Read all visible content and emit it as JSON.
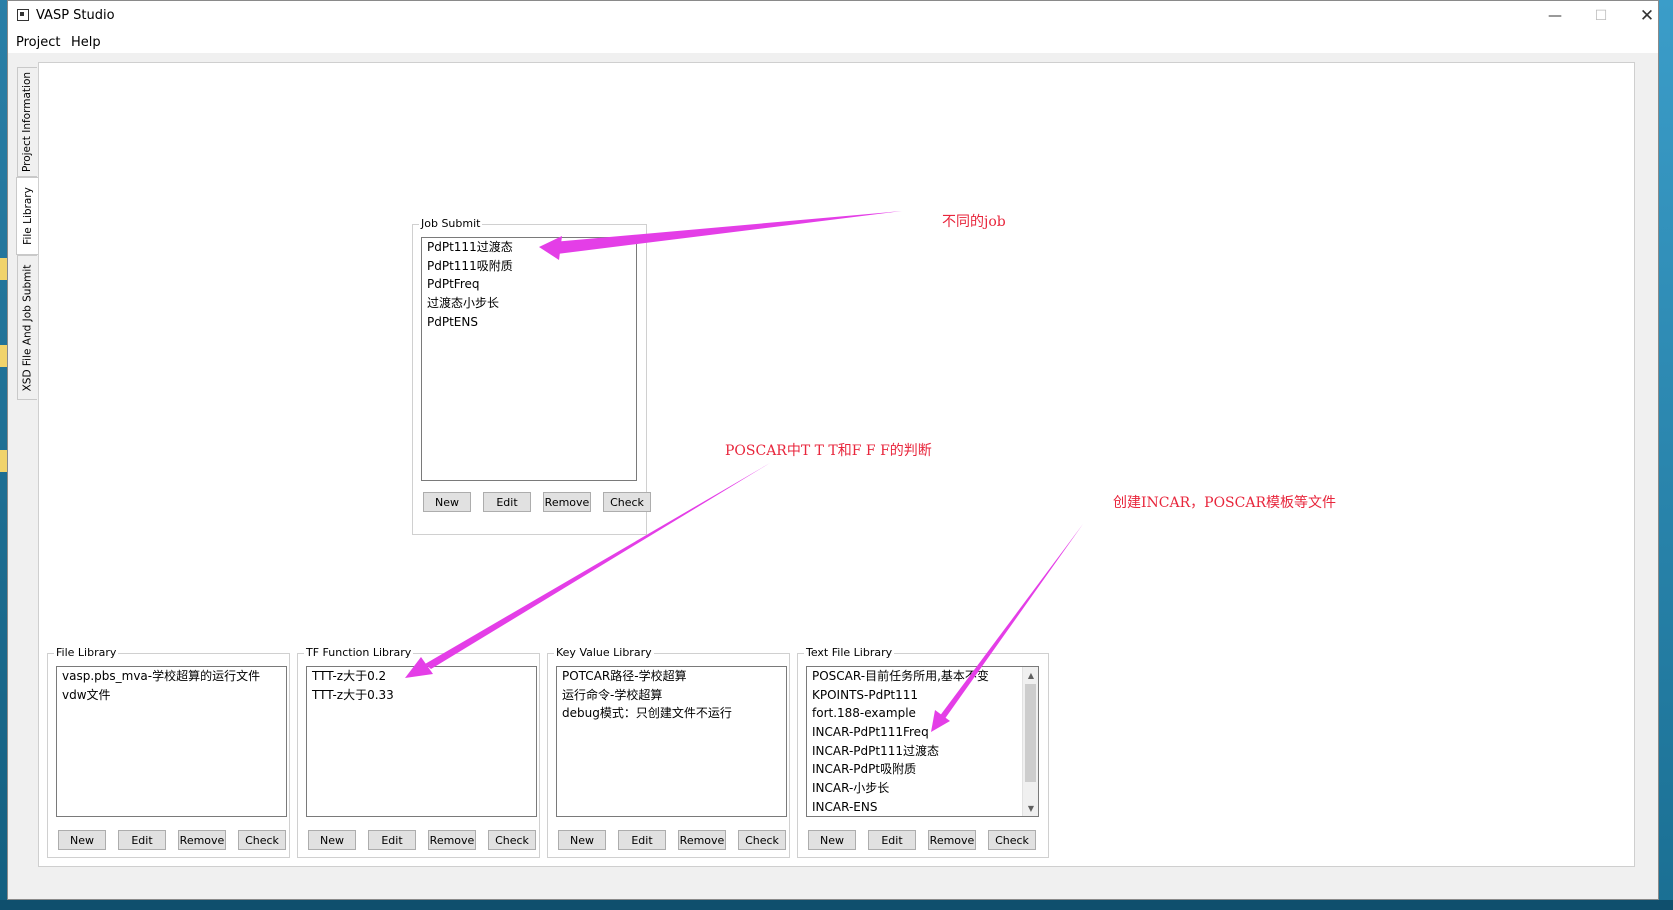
{
  "window": {
    "title": "VASP Studio"
  },
  "menu": {
    "items": [
      "Project",
      "Help"
    ]
  },
  "side_tabs": [
    "Project Information",
    "File Library",
    "XSD File And Job Submit"
  ],
  "buttons": {
    "new": "New",
    "edit": "Edit",
    "remove": "Remove",
    "check": "Check"
  },
  "job_submit": {
    "title": "Job Submit",
    "items": [
      "PdPt111过渡态",
      "PdPt111吸附质",
      "PdPtFreq",
      "过渡态小步长",
      "PdPtENS"
    ]
  },
  "file_library": {
    "title": "File Library",
    "items": [
      "vasp.pbs_mva-学校超算的运行文件",
      "vdw文件"
    ]
  },
  "tf_library": {
    "title": "TF Function Library",
    "items": [
      "TTT-z大于0.2",
      "TTT-z大于0.33"
    ]
  },
  "kv_library": {
    "title": "Key Value Library",
    "items": [
      "POTCAR路径-学校超算",
      "运行命令-学校超算",
      "debug模式：只创建文件不运行"
    ]
  },
  "text_library": {
    "title": "Text File Library",
    "items": [
      "POSCAR-目前任务所用,基本不变",
      "KPOINTS-PdPt111",
      "fort.188-example",
      "INCAR-PdPt111Freq",
      "INCAR-PdPt111过渡态",
      "INCAR-PdPt吸附质",
      "INCAR-小步长",
      "INCAR-ENS"
    ]
  },
  "annotations": {
    "job": "不同的job",
    "tf": "POSCAR中T T T和F F F的判断",
    "text": "创建INCAR，POSCAR模板等文件"
  },
  "colors": {
    "annotation_text": "#e8263c",
    "arrow": "#e43ee7"
  }
}
